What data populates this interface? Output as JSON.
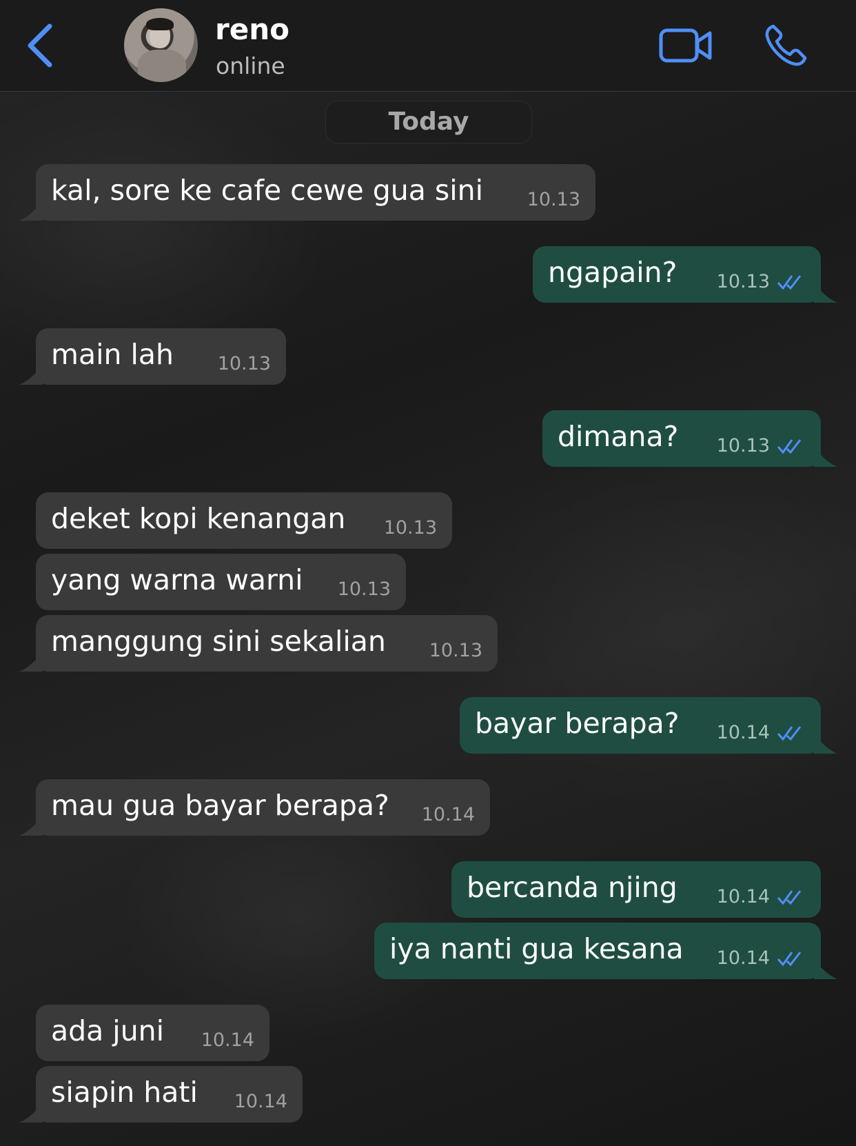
{
  "colors": {
    "accent": "#4f8ff7",
    "incoming_bubble": "#3a3a3b",
    "outgoing_bubble": "#1f4d42",
    "read_ticks": "#4f8ff7"
  },
  "header": {
    "back_icon": "chevron-left-icon",
    "contact_name": "reno",
    "status": "online",
    "video_icon": "video-camera-icon",
    "call_icon": "phone-icon"
  },
  "date_separator": "Today",
  "messages": [
    {
      "direction": "in",
      "text": "kal, sore ke cafe cewe gua sini",
      "time": "10.13"
    },
    {
      "direction": "out",
      "text": "ngapain?",
      "time": "10.13",
      "status": "read"
    },
    {
      "direction": "in",
      "text": "main lah",
      "time": "10.13"
    },
    {
      "direction": "out",
      "text": "dimana?",
      "time": "10.13",
      "status": "read"
    },
    {
      "direction": "in",
      "text": "deket kopi kenangan",
      "time": "10.13"
    },
    {
      "direction": "in",
      "text": "yang warna warni",
      "time": "10.13"
    },
    {
      "direction": "in",
      "text": "manggung sini sekalian",
      "time": "10.13"
    },
    {
      "direction": "out",
      "text": "bayar berapa?",
      "time": "10.14",
      "status": "read"
    },
    {
      "direction": "in",
      "text": "mau gua bayar berapa?",
      "time": "10.14"
    },
    {
      "direction": "out",
      "text": "bercanda njing",
      "time": "10.14",
      "status": "read"
    },
    {
      "direction": "out",
      "text": "iya nanti gua kesana",
      "time": "10.14",
      "status": "read"
    },
    {
      "direction": "in",
      "text": "ada juni",
      "time": "10.14"
    },
    {
      "direction": "in",
      "text": "siapin hati",
      "time": "10.14"
    }
  ]
}
